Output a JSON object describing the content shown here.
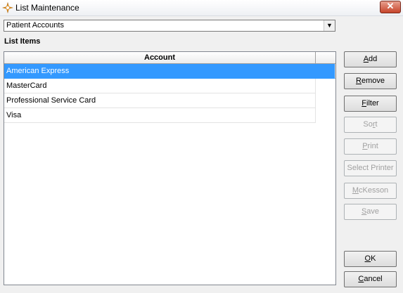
{
  "window": {
    "title": "List Maintenance"
  },
  "combo": {
    "value": "Patient Accounts",
    "arrow": "▼"
  },
  "section_label": "List Items",
  "grid": {
    "column_header": "Account",
    "rows": [
      {
        "value": "American Express",
        "selected": true
      },
      {
        "value": "MasterCard"
      },
      {
        "value": "Professional Service Card"
      },
      {
        "value": "Visa"
      }
    ]
  },
  "buttons": {
    "add": {
      "pre": "",
      "ul": "A",
      "post": "dd"
    },
    "remove": {
      "pre": "",
      "ul": "R",
      "post": "emove"
    },
    "filter": {
      "pre": "",
      "ul": "F",
      "post": "ilter"
    },
    "sort": {
      "pre": "So",
      "ul": "r",
      "post": "t"
    },
    "print": {
      "pre": "",
      "ul": "P",
      "post": "rint"
    },
    "select_printer": {
      "pre": "Select Printer",
      "ul": "",
      "post": ""
    },
    "mckesson": {
      "pre": "",
      "ul": "M",
      "post": "cKesson"
    },
    "save": {
      "pre": "",
      "ul": "S",
      "post": "ave"
    },
    "ok": {
      "pre": "",
      "ul": "O",
      "post": "K"
    },
    "cancel": {
      "pre": "",
      "ul": "C",
      "post": "ancel"
    }
  },
  "icons": {
    "app": "gear-star-icon",
    "close": "close-icon"
  },
  "colors": {
    "selection": "#3399ff",
    "close_button": "#c6442a"
  }
}
